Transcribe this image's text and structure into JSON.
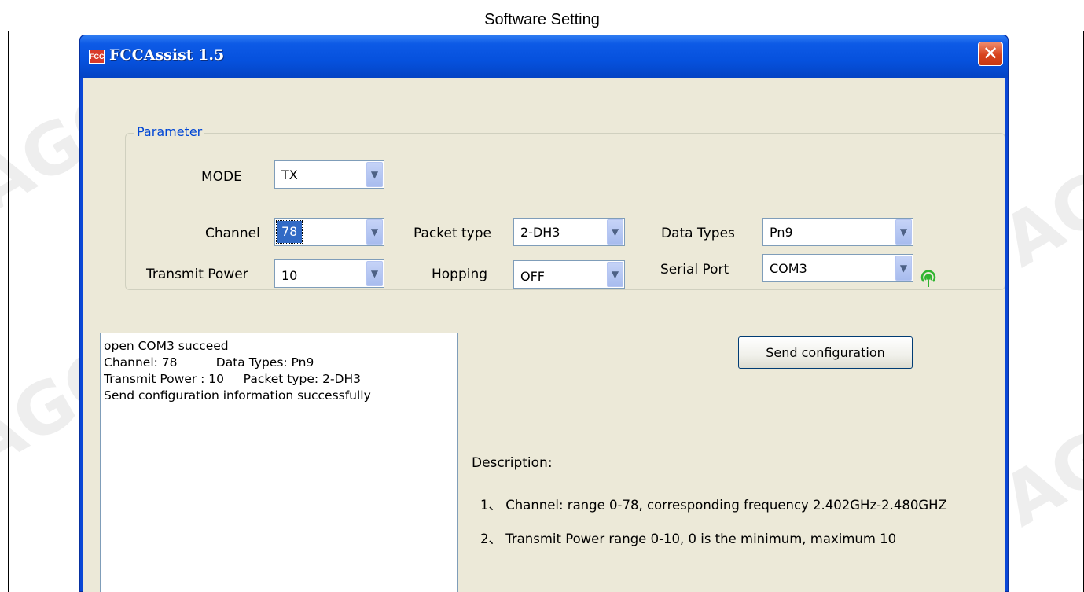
{
  "page": {
    "heading": "Software Setting"
  },
  "window": {
    "title": "FCCAssist 1.5",
    "icon_text": "FCC",
    "close_label": "✕"
  },
  "parameter": {
    "legend": "Parameter",
    "mode": {
      "label": "MODE",
      "value": "TX"
    },
    "channel": {
      "label": "Channel",
      "value": "78"
    },
    "packet_type": {
      "label": "Packet type",
      "value": "2-DH3"
    },
    "data_types": {
      "label": "Data Types",
      "value": "Pn9"
    },
    "transmit_power": {
      "label": "Transmit Power",
      "value": "10"
    },
    "hopping": {
      "label": "Hopping",
      "value": "OFF"
    },
    "serial_port": {
      "label": "Serial Port",
      "value": "COM3"
    }
  },
  "log": {
    "lines": [
      "open COM3 succeed",
      "Channel: 78          Data Types: Pn9",
      "Transmit Power : 10     Packet type: 2-DH3",
      "Send configuration information successfully"
    ]
  },
  "send_button": {
    "label": "Send configuration"
  },
  "description": {
    "title": "Description:",
    "items": [
      "1、 Channel: range 0-78, corresponding frequency 2.402GHz-2.480GHZ",
      "2、 Transmit Power  range 0-10, 0 is the minimum, maximum 10"
    ]
  },
  "icons": {
    "signal": "signal-status-icon",
    "dropdown": "chevron-down-icon"
  },
  "colors": {
    "titlebar": "#0651dd",
    "client": "#ece9d8",
    "legend": "#0046d5",
    "signal": "#2fb52f"
  }
}
